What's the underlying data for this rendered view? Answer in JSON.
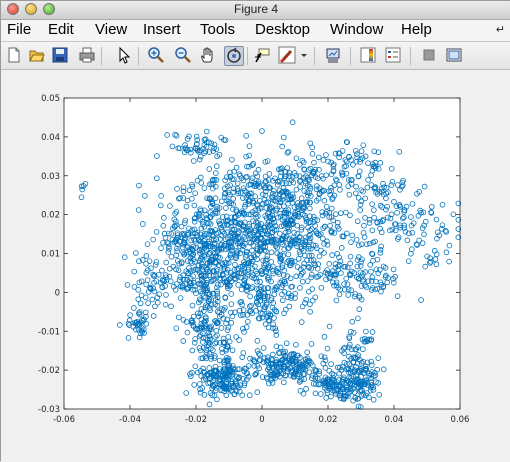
{
  "window": {
    "title": "Figure 4",
    "menus": [
      "File",
      "Edit",
      "View",
      "Insert",
      "Tools",
      "Desktop",
      "Window",
      "Help"
    ],
    "menu_overflow_icon": "curved-arrow-icon",
    "toolbar_icons": [
      "new-figure-icon",
      "open-file-icon",
      "save-icon",
      "print-icon",
      "pointer-icon",
      "zoom-in-icon",
      "zoom-out-icon",
      "pan-hand-icon",
      "rotate-3d-icon",
      "data-cursor-icon",
      "brush-icon",
      "brush-dropdown-icon",
      "link-plot-icon",
      "colorbar-icon",
      "legend-icon",
      "hide-plot-tools-icon",
      "show-plot-tools-icon"
    ]
  },
  "chart_data": {
    "type": "scatter",
    "marker": "circle-open",
    "color": "#0072BD",
    "xlim": [
      -0.06,
      0.06
    ],
    "ylim": [
      -0.03,
      0.05
    ],
    "x_ticks": [
      "-0.06",
      "-0.04",
      "-0.02",
      "0",
      "0.02",
      "0.04",
      "0.06"
    ],
    "y_ticks": [
      "-0.03",
      "-0.02",
      "-0.01",
      "0",
      "0.01",
      "0.02",
      "0.03",
      "0.04",
      "0.05"
    ],
    "grid": false,
    "clusters": [
      {
        "cx": -0.006,
        "cy": 0.014,
        "sx": 0.012,
        "sy": 0.008,
        "n": 650
      },
      {
        "cx": 0.012,
        "cy": 0.022,
        "sx": 0.012,
        "sy": 0.007,
        "n": 260
      },
      {
        "cx": -0.018,
        "cy": 0.006,
        "sx": 0.006,
        "sy": 0.006,
        "n": 180
      },
      {
        "cx": -0.015,
        "cy": -0.01,
        "sx": 0.004,
        "sy": 0.006,
        "n": 140
      },
      {
        "cx": -0.012,
        "cy": -0.022,
        "sx": 0.004,
        "sy": 0.003,
        "n": 170
      },
      {
        "cx": 0.008,
        "cy": -0.019,
        "sx": 0.006,
        "sy": 0.002,
        "n": 180
      },
      {
        "cx": 0.022,
        "cy": -0.024,
        "sx": 0.005,
        "sy": 0.002,
        "n": 120
      },
      {
        "cx": 0.03,
        "cy": -0.022,
        "sx": 0.003,
        "sy": 0.003,
        "n": 90
      },
      {
        "cx": 0.044,
        "cy": 0.018,
        "sx": 0.008,
        "sy": 0.004,
        "n": 90
      },
      {
        "cx": 0.03,
        "cy": 0.004,
        "sx": 0.007,
        "sy": 0.003,
        "n": 80
      },
      {
        "cx": 0.024,
        "cy": 0.033,
        "sx": 0.007,
        "sy": 0.003,
        "n": 60
      },
      {
        "cx": -0.018,
        "cy": 0.037,
        "sx": 0.004,
        "sy": 0.002,
        "n": 50
      },
      {
        "cx": -0.034,
        "cy": 0.003,
        "sx": 0.004,
        "sy": 0.003,
        "n": 45
      },
      {
        "cx": -0.037,
        "cy": -0.009,
        "sx": 0.002,
        "sy": 0.002,
        "n": 35
      },
      {
        "cx": -0.024,
        "cy": 0.014,
        "sx": 0.004,
        "sy": 0.003,
        "n": 40
      },
      {
        "cx": 0.002,
        "cy": 0.028,
        "sx": 0.01,
        "sy": 0.002,
        "n": 70
      },
      {
        "cx": 0.014,
        "cy": 0.005,
        "sx": 0.008,
        "sy": 0.006,
        "n": 110
      },
      {
        "cx": 0.0,
        "cy": -0.004,
        "sx": 0.005,
        "sy": 0.004,
        "n": 70
      },
      {
        "cx": 0.027,
        "cy": -0.016,
        "sx": 0.002,
        "sy": 0.003,
        "n": 30
      },
      {
        "cx": 0.032,
        "cy": -0.012,
        "sx": 0.001,
        "sy": 0.001,
        "n": 10
      },
      {
        "cx": -0.055,
        "cy": 0.027,
        "sx": 0.0006,
        "sy": 0.0009,
        "n": 5
      },
      {
        "cx": 0.054,
        "cy": 0.01,
        "sx": 0.002,
        "sy": 0.003,
        "n": 12
      },
      {
        "cx": 0.04,
        "cy": 0.027,
        "sx": 0.006,
        "sy": 0.001,
        "n": 18
      },
      {
        "cx": 0.034,
        "cy": 0.033,
        "sx": 0.001,
        "sy": 0.0005,
        "n": 6
      }
    ]
  }
}
